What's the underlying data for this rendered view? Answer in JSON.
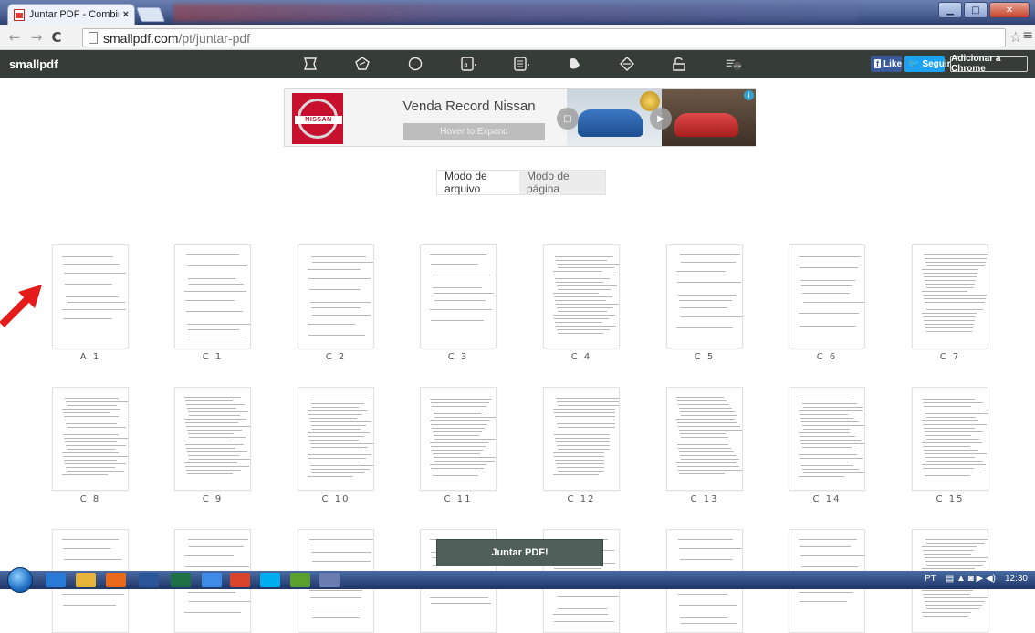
{
  "browser": {
    "tab_title": "Juntar PDF - Combinar se",
    "tab_close": "×",
    "url_host": "smallpdf.com",
    "url_path": "/pt/juntar-pdf",
    "back": "←",
    "forward": "→",
    "reload": "C",
    "star": "☆",
    "menu": "≡"
  },
  "site": {
    "brand": "smallpdf",
    "tools": [
      "crop-tool-icon",
      "compress-icon",
      "circle-tool-icon",
      "pdf-to-word-icon",
      "pdf-to-excel-icon",
      "unlock-icon",
      "diamond-icon",
      "lock-icon",
      "new-tool-icon"
    ],
    "new_badge": "NEW",
    "facebook_label": "Like",
    "twitter_label": "Seguir",
    "chrome_label": "Adicionar a Chrome"
  },
  "ad": {
    "brand_logo": "NISSAN",
    "headline": "Venda Record Nissan",
    "hover_text": "Hover to Expand",
    "info": "i"
  },
  "modes": {
    "file_mode": "Modo de arquivo",
    "page_mode": "Modo de página"
  },
  "pages": {
    "row1": [
      "A 1",
      "C 1",
      "C 2",
      "C 3",
      "C 4",
      "C 5",
      "C 6",
      "C 7"
    ],
    "row2": [
      "C 8",
      "C 9",
      "C 10",
      "C 11",
      "C 12",
      "C 13",
      "C 14",
      "C 15"
    ]
  },
  "merge_button": "Juntar PDF!",
  "taskbar": {
    "lang": "PT",
    "time": "12:30"
  },
  "colors": {
    "sitebar": "#363d39",
    "merge": "#4f5e58",
    "arrow": "#e51a1a"
  }
}
